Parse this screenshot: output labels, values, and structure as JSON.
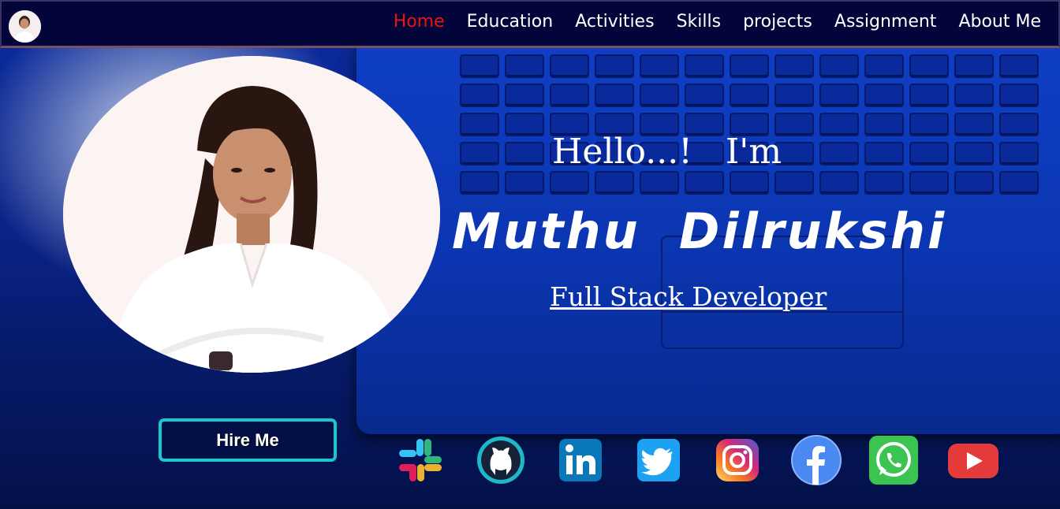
{
  "nav": {
    "links": [
      {
        "label": "Home",
        "active": true
      },
      {
        "label": "Education"
      },
      {
        "label": "Activities"
      },
      {
        "label": "Skills"
      },
      {
        "label": "projects"
      },
      {
        "label": "Assignment"
      },
      {
        "label": "About Me"
      }
    ]
  },
  "hero": {
    "greeting": "Hello...!   I'm",
    "name": "Muthu  Dilrukshi",
    "role": "Full Stack Developer",
    "hire_label": "Hire Me"
  },
  "socials": [
    "slack-icon",
    "github-icon",
    "linkedin-icon",
    "twitter-icon",
    "instagram-icon",
    "facebook-icon",
    "whatsapp-icon",
    "youtube-icon"
  ],
  "colors": {
    "nav_bg": "#03053a",
    "active_link": "#ee1111",
    "hire_border": "#18c8cc",
    "hero_blue": "#0a2a9a"
  }
}
